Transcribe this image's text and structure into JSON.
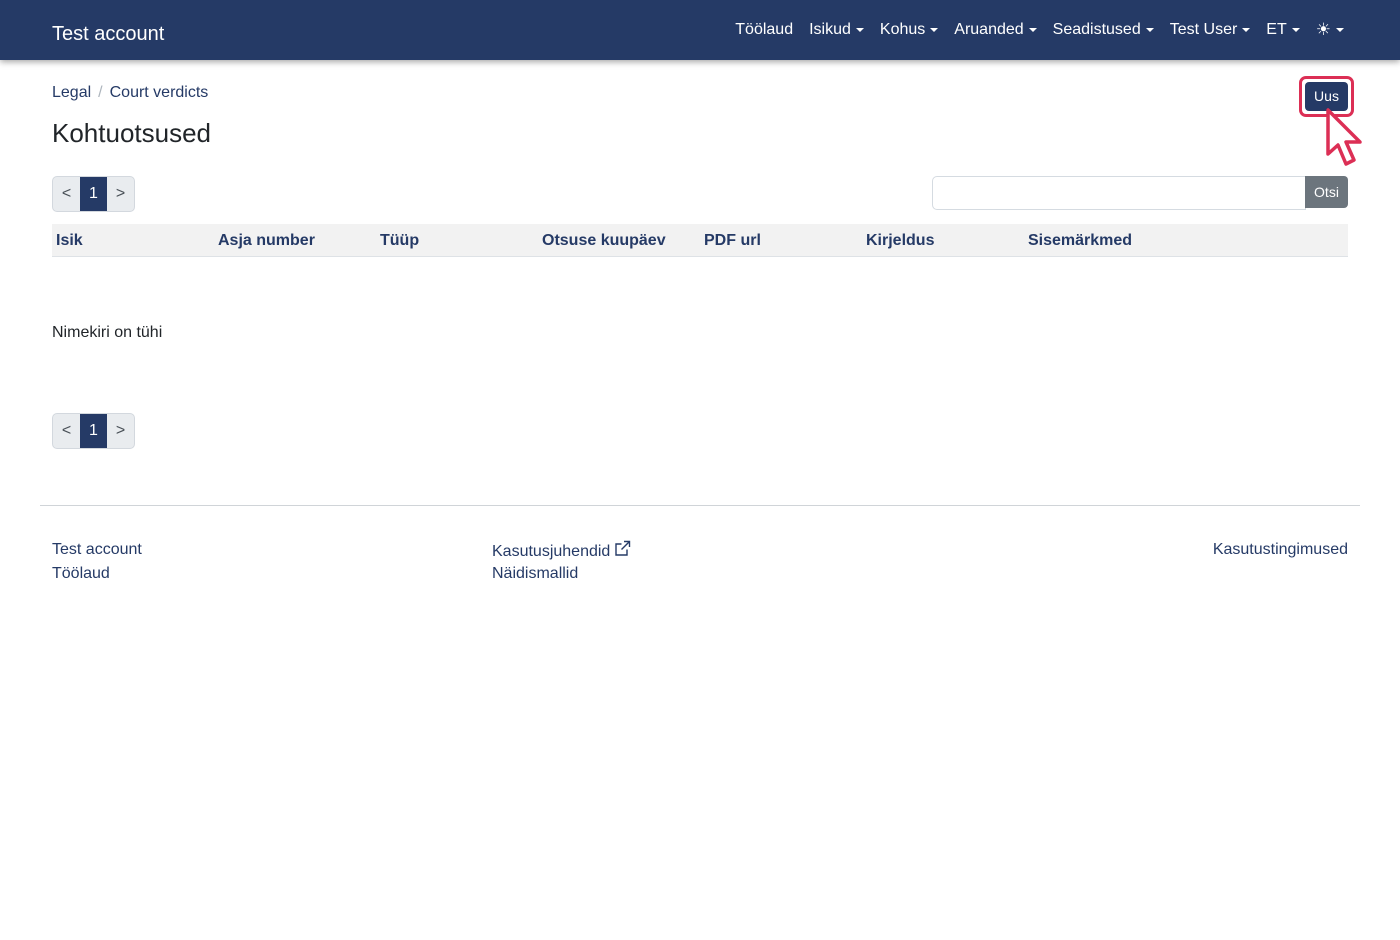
{
  "navbar": {
    "brand": "Test account",
    "items": [
      {
        "label": "Töölaud",
        "dropdown": false
      },
      {
        "label": "Isikud",
        "dropdown": true
      },
      {
        "label": "Kohus",
        "dropdown": true
      },
      {
        "label": "Aruanded",
        "dropdown": true
      },
      {
        "label": "Seadistused",
        "dropdown": true
      },
      {
        "label": "Test User",
        "dropdown": true
      },
      {
        "label": "ET",
        "dropdown": true
      }
    ],
    "theme_icon": "sun-icon",
    "theme_glyph": "☀"
  },
  "breadcrumb": {
    "parent": "Legal",
    "separator": "/",
    "current": "Court verdicts"
  },
  "page": {
    "title": "Kohtuotsused",
    "new_button": "Uus"
  },
  "pagination": {
    "prev": "<",
    "current": "1",
    "next": ">"
  },
  "search": {
    "value": "",
    "placeholder": "",
    "button": "Otsi"
  },
  "table": {
    "columns": [
      "Isik",
      "Asja number",
      "Tüüp",
      "Otsuse kuupäev",
      "PDF url",
      "Kirjeldus",
      "Sisemärkmed"
    ],
    "rows": [],
    "empty_message": "Nimekiri on tühi"
  },
  "footer": {
    "col1": [
      "Test account",
      "Töölaud"
    ],
    "col2": [
      "Kasutusjuhendid",
      "Näidismallid"
    ],
    "col3": [
      "Kasutustingimused"
    ],
    "external_icon": "external-link-icon"
  },
  "colors": {
    "primary": "#253a66",
    "highlight": "#dc2f55",
    "secondary": "#6c757d"
  }
}
